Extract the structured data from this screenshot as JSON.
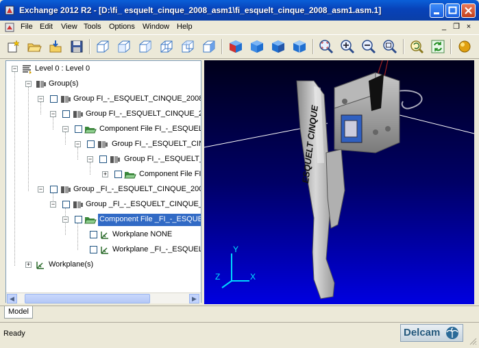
{
  "window": {
    "title": "Exchange 2012 R2 - [D:\\fi_ esquelt_cinque_2008_asm1\\fi_esquelt_cinque_2008_asm1.asm.1]"
  },
  "menu": {
    "items": [
      "File",
      "Edit",
      "View",
      "Tools",
      "Options",
      "Window",
      "Help"
    ]
  },
  "mdi_controls": {
    "minimize": "_",
    "restore": "❐",
    "close": "×"
  },
  "toolbar": {
    "buttons": [
      "new-model-icon",
      "open-folder-icon",
      "import-icon",
      "save-icon",
      "view-iso-1-icon",
      "view-iso-2-icon",
      "view-iso-3-icon",
      "view-iso-4-icon",
      "view-iso-5-icon",
      "view-iso-6-icon",
      "shaded-cube-1-icon",
      "shaded-cube-2-icon",
      "shaded-cube-3-icon",
      "shaded-cube-4-icon",
      "zoom-fit-icon",
      "zoom-in-icon",
      "zoom-out-icon",
      "zoom-box-icon",
      "undo-view-icon",
      "refresh-icon",
      "material-sphere-icon"
    ]
  },
  "tree": {
    "rows": [
      {
        "label": "Level 0 : Level 0"
      },
      {
        "label": "Group(s)"
      },
      {
        "label": "Group FI_-_ESQUELT_CINQUE_2008_S"
      },
      {
        "label": "Group FI_-_ESQUELT_CINQUE_20"
      },
      {
        "label": "Component File FI_-_ESQUELT"
      },
      {
        "label": "Group FI_-_ESQUELT_CINQ"
      },
      {
        "label": "Group FI_-_ESQUELT_("
      },
      {
        "label": "Component File FI_"
      },
      {
        "label": "Group _FI_-_ESQUELT_CINQUE_2008_"
      },
      {
        "label": "Group _FI_-_ESQUELT_CINQUE_20"
      },
      {
        "label": "Component File _FI_-_ESQUEL"
      },
      {
        "label": "Workplane NONE"
      },
      {
        "label": "Workplane _FI_-_ESQUELT"
      },
      {
        "label": "Workplane(s)"
      }
    ]
  },
  "viewport": {
    "part_text": "ESQUELT CINQUE",
    "axis_x": "X",
    "axis_y": "Y",
    "axis_z": "Z"
  },
  "tabs": {
    "model": "Model"
  },
  "status": {
    "text": "Ready"
  },
  "logo": {
    "text": "Delcam"
  },
  "colors": {
    "selection": "#316ac5",
    "title_bar": "#0842b8",
    "viewport_top": "#00001a",
    "viewport_bottom": "#0000e0"
  }
}
